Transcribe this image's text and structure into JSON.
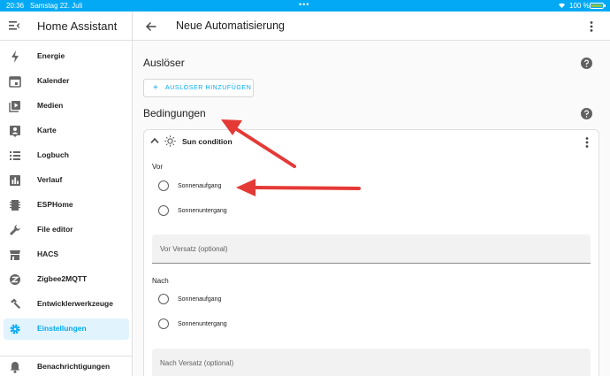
{
  "statusbar": {
    "time": "20:36",
    "date": "Samstag 22. Juli",
    "dots": "•••",
    "battery": "100 %"
  },
  "sidebar": {
    "menu_icon": "menu-icon",
    "title": "Home Assistant",
    "items": [
      {
        "label": "Energie",
        "icon": "lightning-icon"
      },
      {
        "label": "Kalender",
        "icon": "calendar-icon"
      },
      {
        "label": "Medien",
        "icon": "media-icon"
      },
      {
        "label": "Karte",
        "icon": "map-person-icon"
      },
      {
        "label": "Logbuch",
        "icon": "list-icon"
      },
      {
        "label": "Verlauf",
        "icon": "chart-icon"
      },
      {
        "label": "ESPHome",
        "icon": "chip-icon"
      },
      {
        "label": "File editor",
        "icon": "wrench-icon"
      },
      {
        "label": "HACS",
        "icon": "store-icon"
      },
      {
        "label": "Zigbee2MQTT",
        "icon": "zigbee-icon"
      },
      {
        "label": "Entwicklerwerkzeuge",
        "icon": "hammer-icon"
      },
      {
        "label": "Einstellungen",
        "icon": "gear-icon"
      }
    ],
    "notifications": {
      "label": "Benachrichtigungen",
      "icon": "bell-icon"
    }
  },
  "topbar": {
    "title": "Neue Automatisierung"
  },
  "triggers": {
    "title": "Auslöser",
    "add_button": "AUSLÖSER HINZUFÜGEN"
  },
  "conditions": {
    "title": "Bedingungen",
    "card": {
      "title": "Sun condition",
      "before": {
        "label": "Vor",
        "options": [
          "Sonnenaufgang",
          "Sonnenuntergang"
        ],
        "offset_label": "Vor Versatz (optional)"
      },
      "after": {
        "label": "Nach",
        "options": [
          "Sonnenaufgang",
          "Sonnenuntergang"
        ],
        "offset_label": "Nach Versatz (optional)"
      }
    }
  },
  "colors": {
    "accent": "#03a9f4",
    "active_bg": "#e1f3fd",
    "annotation_arrow": "#e53935"
  }
}
